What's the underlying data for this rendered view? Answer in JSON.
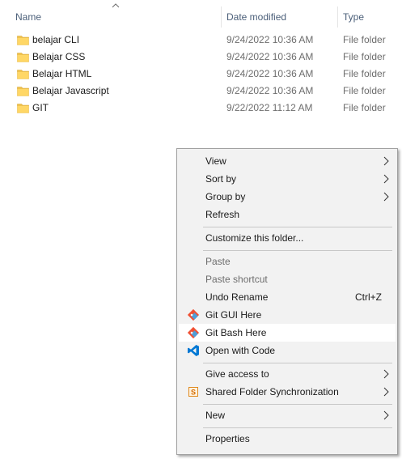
{
  "columns": {
    "name": "Name",
    "date_modified": "Date modified",
    "type": "Type"
  },
  "files": [
    {
      "name": "belajar CLI",
      "date": "9/24/2022 10:36 AM",
      "type": "File folder"
    },
    {
      "name": "Belajar CSS",
      "date": "9/24/2022 10:36 AM",
      "type": "File folder"
    },
    {
      "name": "Belajar HTML",
      "date": "9/24/2022 10:36 AM",
      "type": "File folder"
    },
    {
      "name": "Belajar Javascript",
      "date": "9/24/2022 10:36 AM",
      "type": "File folder"
    },
    {
      "name": "GIT",
      "date": "9/22/2022 11:12 AM",
      "type": "File folder"
    }
  ],
  "context_menu": {
    "view": "View",
    "sort_by": "Sort by",
    "group_by": "Group by",
    "refresh": "Refresh",
    "customize": "Customize this folder...",
    "paste": "Paste",
    "paste_shortcut": "Paste shortcut",
    "undo_rename": "Undo Rename",
    "undo_shortcut": "Ctrl+Z",
    "git_gui": "Git GUI Here",
    "git_bash": "Git Bash Here",
    "open_code": "Open with Code",
    "give_access": "Give access to",
    "shared_sync": "Shared Folder Synchronization",
    "new": "New",
    "properties": "Properties"
  },
  "colors": {
    "header_text": "#4c607a",
    "folder_yellow": "#ffd766",
    "menu_bg": "#f2f2f2",
    "vscode_blue": "#0078d4",
    "git_orange": "#f05033"
  }
}
